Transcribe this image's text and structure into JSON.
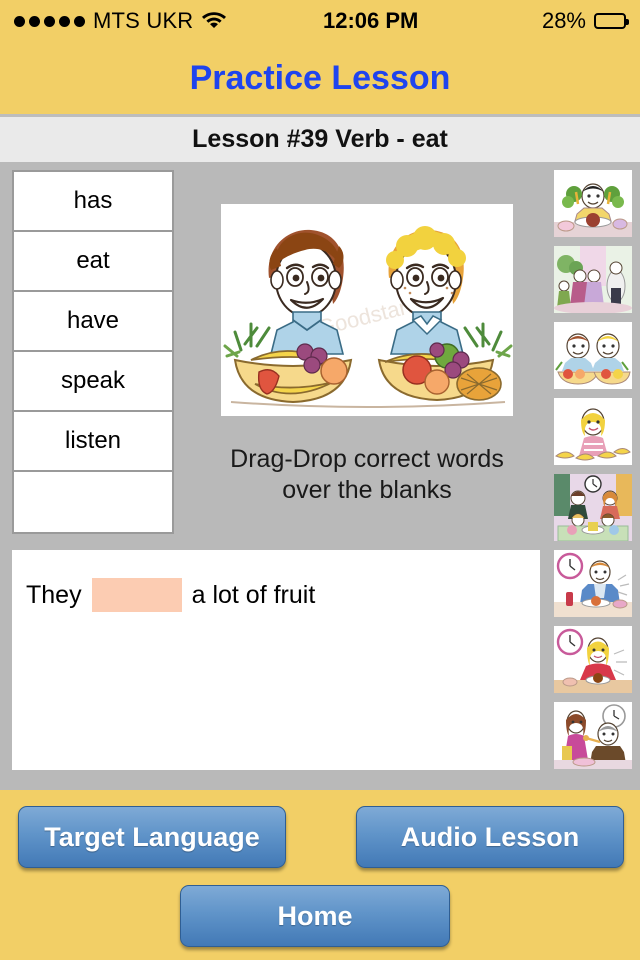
{
  "statusbar": {
    "carrier": "MTS UKR",
    "signal_dots": 5,
    "wifi_icon": "wifi-icon",
    "time": "12:06 PM",
    "battery_percent": "28%",
    "battery_level": 28
  },
  "header": {
    "app_title": "Practice Lesson",
    "app_title_color": "#1F44EE",
    "background_color": "#F2CF66"
  },
  "lesson": {
    "title": "Lesson #39 Verb - eat"
  },
  "wordbank": {
    "words": [
      "has",
      "eat",
      "have",
      "speak",
      "listen",
      ""
    ]
  },
  "main": {
    "hero_image_alt": "two-boys-with-fruit-bowls-illustration",
    "instructions_line1": "Drag-Drop correct words",
    "instructions_line2": "over the blanks"
  },
  "thumbnails": [
    {
      "name": "thumb-man-eating-salad"
    },
    {
      "name": "thumb-family-party"
    },
    {
      "name": "thumb-two-boys-fruit"
    },
    {
      "name": "thumb-girl-with-bananas"
    },
    {
      "name": "thumb-family-dinner-clock"
    },
    {
      "name": "thumb-boy-eating-clock"
    },
    {
      "name": "thumb-woman-eating-clock"
    },
    {
      "name": "thumb-woman-feeding-man-clock"
    }
  ],
  "sentence": {
    "before_blank": "They",
    "blank_value": "",
    "blank_color": "#FCCCB2",
    "after_blank": "a lot of fruit"
  },
  "footer": {
    "target_language_label": "Target Language",
    "audio_lesson_label": "Audio Lesson",
    "home_label": "Home",
    "button_color": "#4279B6"
  }
}
